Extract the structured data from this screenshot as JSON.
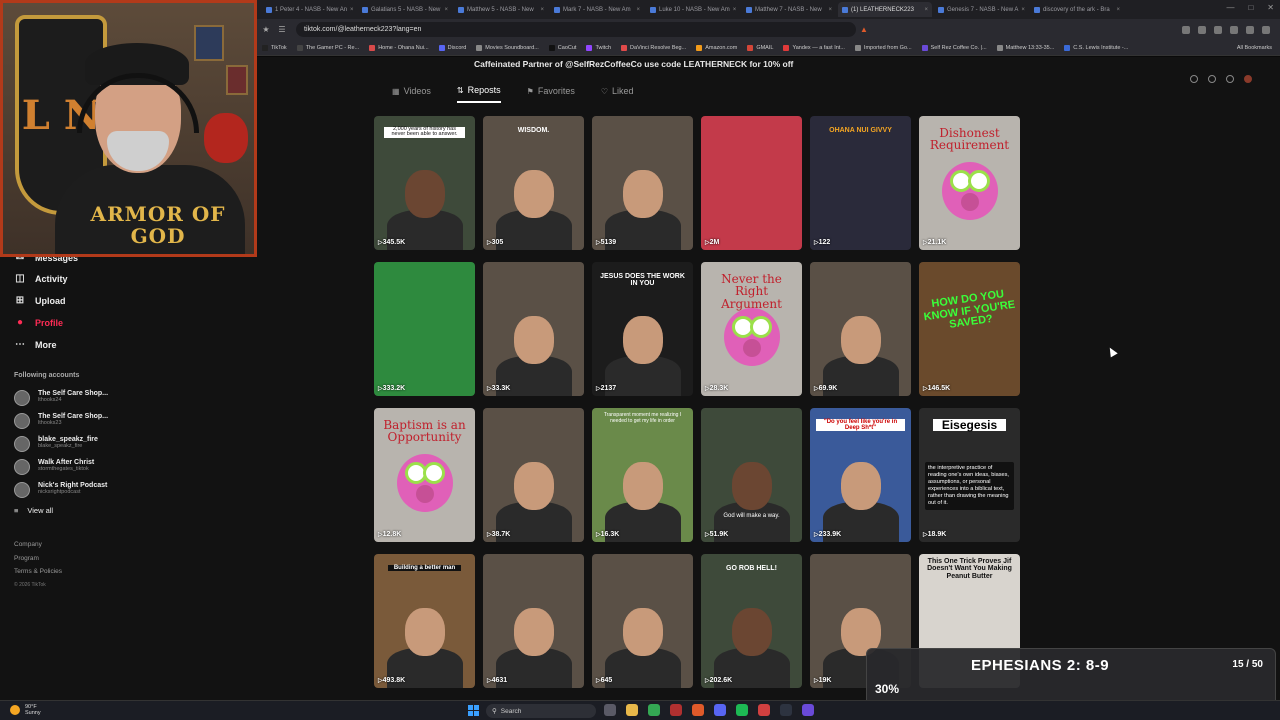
{
  "browser": {
    "tabs": [
      {
        "label": "1 Peter 4 - NASB - New An",
        "active": false
      },
      {
        "label": "Galatians 5 - NASB - New",
        "active": false
      },
      {
        "label": "Matthew 5 - NASB - New",
        "active": false
      },
      {
        "label": "Mark 7 - NASB - New Am",
        "active": false
      },
      {
        "label": "Luke 10 - NASB - New Am",
        "active": false
      },
      {
        "label": "Matthew 7 - NASB - New",
        "active": false
      },
      {
        "label": "(1) LEATHERNECK223",
        "active": true
      },
      {
        "label": "Genesis 7 - NASB - New A",
        "active": false
      },
      {
        "label": "discovery of the ark - Bra",
        "active": false
      }
    ],
    "url": "tiktok.com/@leatherneck223?lang=en",
    "bookmarks": [
      "TikTok",
      "The Gamer PC - Re...",
      "Home - Ohana Nui...",
      "Discord",
      "Movies Soundboard...",
      "CaoCut",
      "Twitch",
      "DaVinci Resolve Beg...",
      "Amazon.com",
      "GMAIL",
      "Yandex — a fast Int...",
      "Imported from Go...",
      "Self Rez Coffee Co. |...",
      "Matthew 13:33-35...",
      "C.S. Lewis Institute -..."
    ],
    "all_bookmarks": "All Bookmarks"
  },
  "profile": {
    "bio": "Caffeinated Partner of @SelfRezCoffeeCo use code LEATHERNECK for 10% off",
    "tabs": [
      {
        "label": "Videos",
        "icon": "grid-icon",
        "active": false
      },
      {
        "label": "Reposts",
        "icon": "repost-icon",
        "active": true
      },
      {
        "label": "Favorites",
        "icon": "bookmark-icon",
        "active": false
      },
      {
        "label": "Liked",
        "icon": "heart-icon",
        "active": false
      }
    ]
  },
  "videos": [
    {
      "caption": "2,000 years of history has never been able to answer.",
      "views": "345.5K",
      "style": "person-dark"
    },
    {
      "caption": "WISDOM.",
      "views": "305",
      "style": "person"
    },
    {
      "caption": "",
      "views": "5139",
      "style": "person"
    },
    {
      "caption": "",
      "views": "2M",
      "style": "blur-red"
    },
    {
      "caption": "OHANA NUI GIVVY",
      "views": "122",
      "style": "flyer"
    },
    {
      "caption": "Dishonest Requirement",
      "views": "21.1K",
      "style": "puppet"
    },
    {
      "caption": "",
      "views": "333.2K",
      "style": "baseball"
    },
    {
      "caption": "",
      "views": "33.3K",
      "style": "person"
    },
    {
      "caption": "JESUS DOES THE WORK IN YOU",
      "views": "2137",
      "style": "duo"
    },
    {
      "caption": "Never the Right Argument",
      "views": "28.3K",
      "style": "puppet"
    },
    {
      "caption": "",
      "views": "69.9K",
      "style": "person"
    },
    {
      "caption": "HOW DO YOU KNOW IF YOU'RE SAVED?",
      "views": "146.5K",
      "style": "door"
    },
    {
      "caption": "Baptism is an Opportunity",
      "views": "12.8K",
      "style": "puppet"
    },
    {
      "caption": "",
      "views": "38.7K",
      "style": "person"
    },
    {
      "caption": "Transparent moment me realizing I needed to get my life in order",
      "views": "16.3K",
      "style": "field"
    },
    {
      "caption": "God will make a way.",
      "views": "51.9K",
      "style": "person-dark"
    },
    {
      "caption": "\"Do you feel like you're in Deep Sh*t\"",
      "views": "233.9K",
      "style": "news"
    },
    {
      "caption": "Eisegesis",
      "views": "18.9K",
      "style": "text"
    },
    {
      "caption": "Building a better man",
      "views": "493.8K",
      "style": "wood"
    },
    {
      "caption": "",
      "views": "4631",
      "style": "person"
    },
    {
      "caption": "",
      "views": "645",
      "style": "person"
    },
    {
      "caption": "GO ROB HELL!",
      "views": "202.6K",
      "style": "person-dark"
    },
    {
      "caption": "",
      "views": "19K",
      "style": "person"
    },
    {
      "caption": "This One Trick Proves Jif Doesn't Want You Making Peanut Butter",
      "views": "",
      "style": "grocery"
    }
  ],
  "eisegesis_text": "the interpretive practice of reading one's own ideas, biases, assumptions, or personal experiences into a biblical text, rather than drawing the meaning out of it.",
  "sidebar": {
    "items": [
      {
        "label": "Messages",
        "icon": "message-icon"
      },
      {
        "label": "Activity",
        "icon": "activity-icon"
      },
      {
        "label": "Upload",
        "icon": "upload-icon"
      },
      {
        "label": "Profile",
        "icon": "profile-icon"
      },
      {
        "label": "More",
        "icon": "more-icon"
      }
    ],
    "following_title": "Following accounts",
    "accounts": [
      {
        "name": "The Self Care Shop...",
        "handle": "lthooks24"
      },
      {
        "name": "The Self Care Shop...",
        "handle": "lthooks23"
      },
      {
        "name": "blake_speakz_fire",
        "handle": "blake_speakz_fire"
      },
      {
        "name": "Walk After Christ",
        "handle": "stormthegates_tiktok"
      },
      {
        "name": "Nick's Right Podcast",
        "handle": "nicksrightpodcast"
      }
    ],
    "view_all": "View all",
    "footer_links": [
      "Company",
      "Program",
      "Terms & Policies"
    ],
    "copyright": "© 2026 TikTok"
  },
  "webcam": {
    "shirt_text": "ARMOR OF GOD",
    "shield_letters": "L N"
  },
  "verse_overlay": {
    "title": "EPHESIANS 2: 8-9",
    "count": "15 / 50",
    "percent_label": "30%",
    "progress": 0.3,
    "accent": "#f0882a"
  },
  "taskbar": {
    "weather_temp": "90°F",
    "weather_desc": "Sunny",
    "search_label": "Search"
  },
  "colors": {
    "accent_red": "#fe2c55",
    "cam_border": "#b23a1a"
  }
}
